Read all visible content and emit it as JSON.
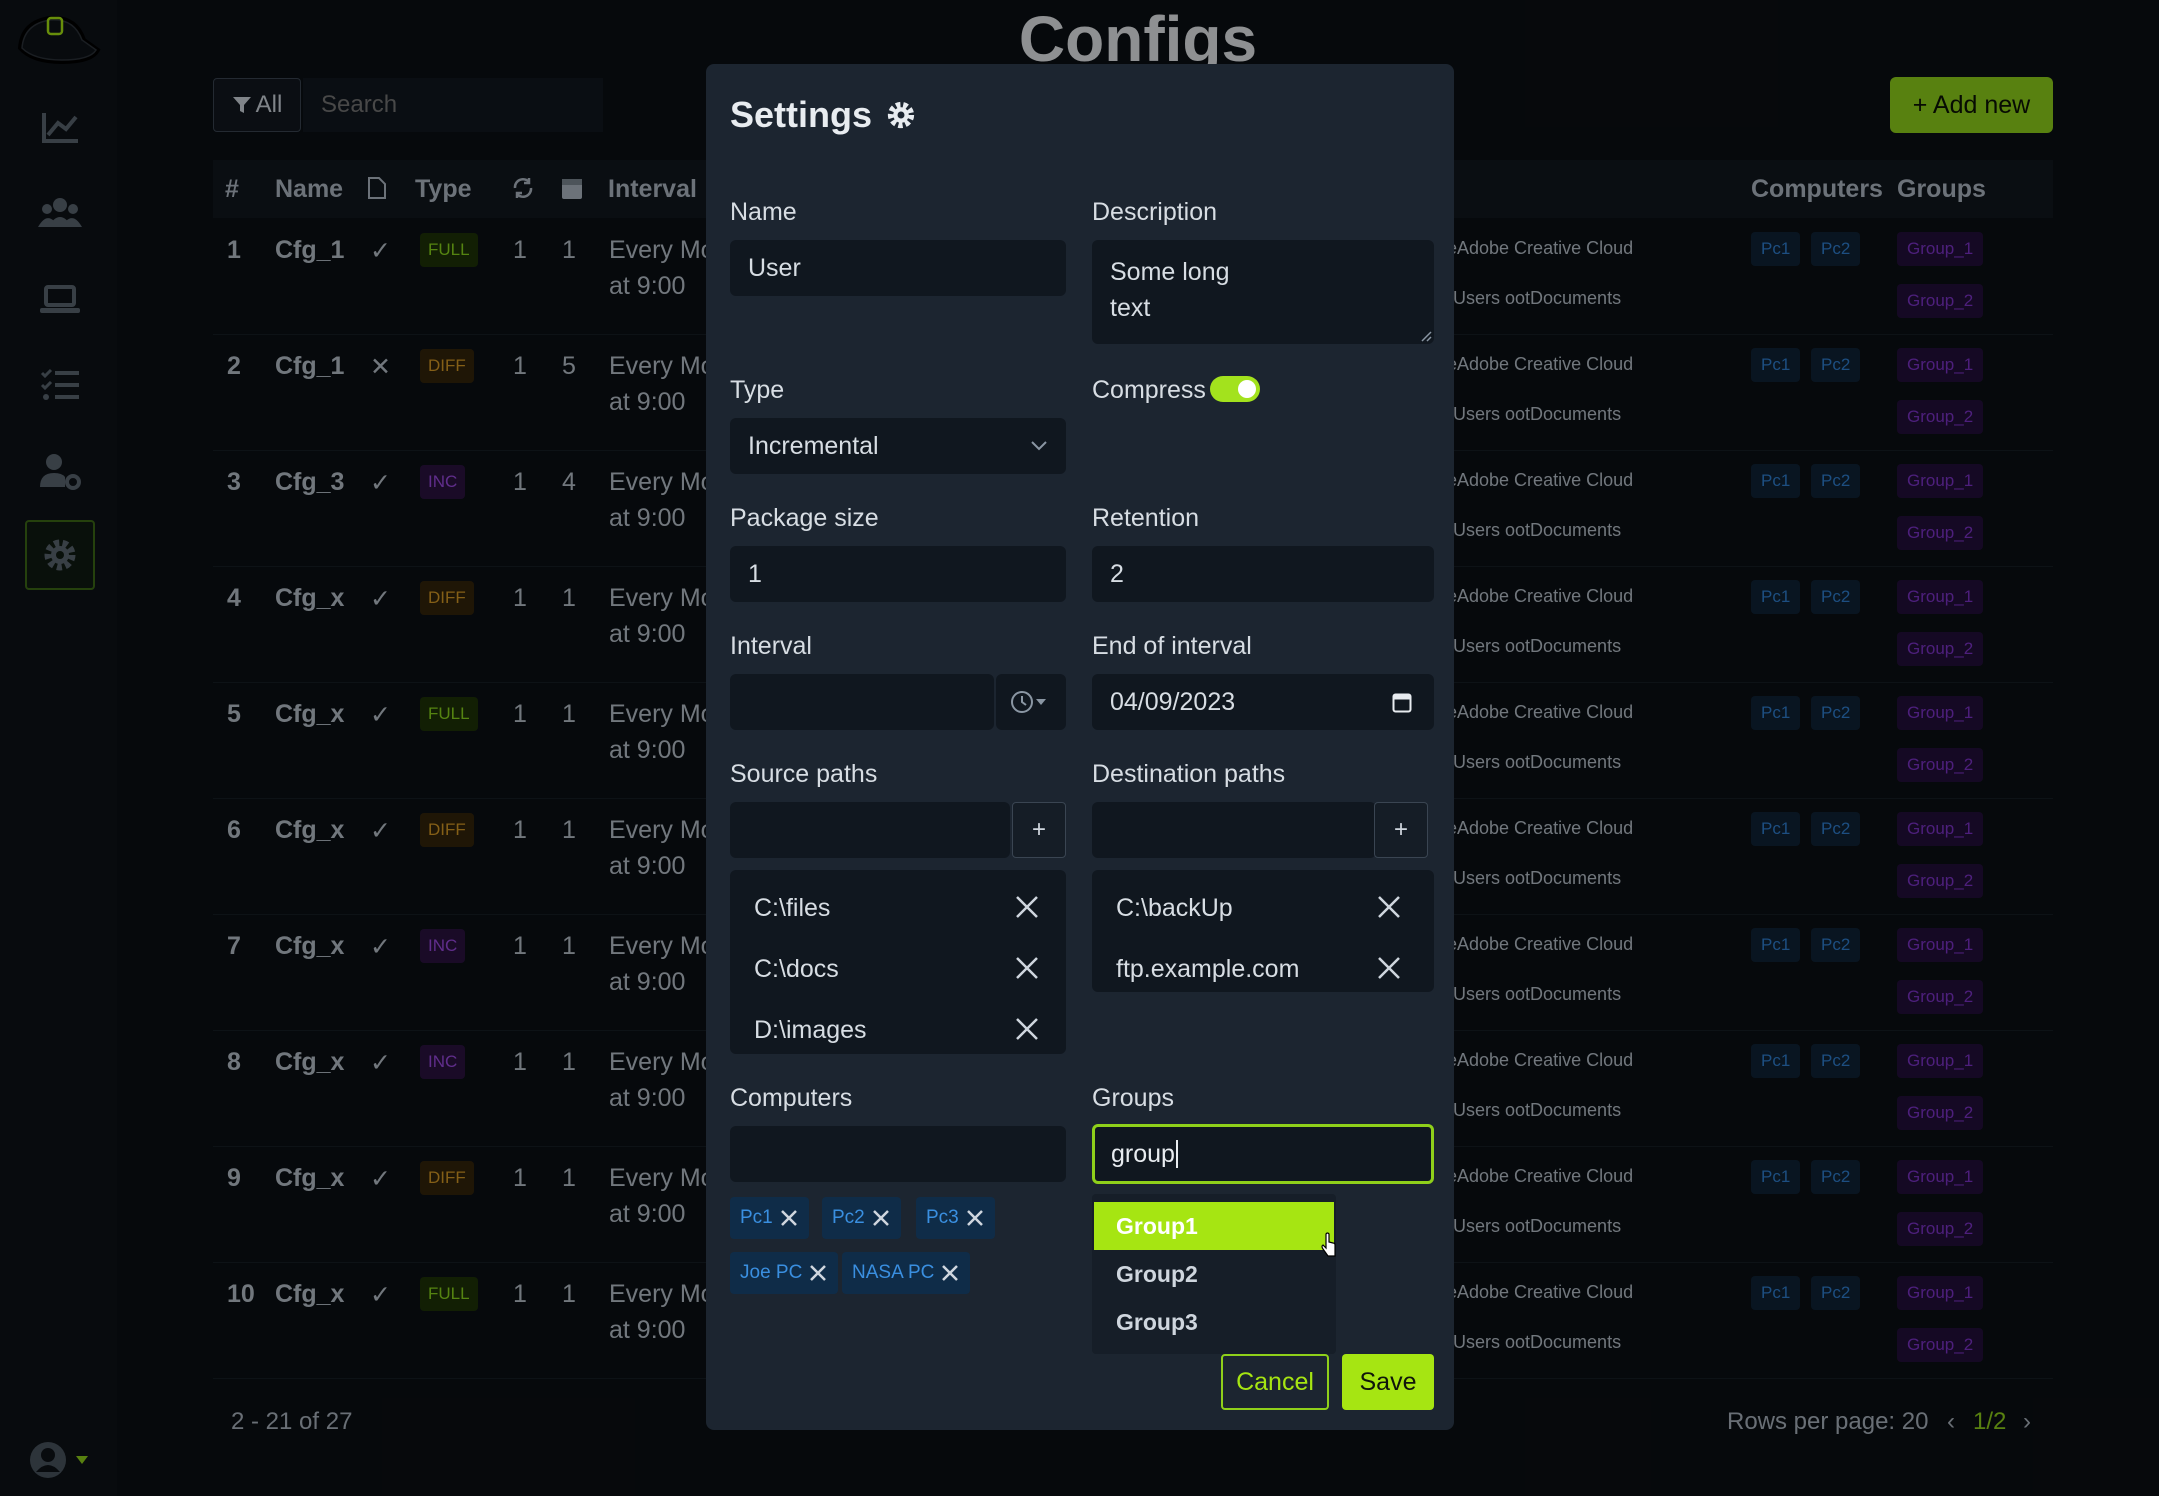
{
  "app": {
    "page_title": "Configs",
    "filter_label": "All",
    "search_placeholder": "Search",
    "add_button": "+ Add new",
    "columns": {
      "num": "#",
      "name": "Name",
      "type": "Type",
      "interval": "Interval",
      "computers": "Computers",
      "groups": "Groups"
    },
    "rows": [
      {
        "num": "1",
        "name": "Cfg_1",
        "check": "✓",
        "type": "FULL",
        "c1": "1",
        "c2": "1",
        "interval1": "Every Mo",
        "interval2": "at 9:00",
        "source": "eAdobe Creative Cloud",
        "dest": "Users ootDocuments",
        "pc1": "Pc1",
        "pc2": "Pc2",
        "g1": "Group_1",
        "g2": "Group_2"
      },
      {
        "num": "2",
        "name": "Cfg_1",
        "check": "✕",
        "type": "DIFF",
        "c1": "1",
        "c2": "5",
        "interval1": "Every Mo",
        "interval2": "at 9:00",
        "source": "eAdobe Creative Cloud",
        "dest": "Users ootDocuments",
        "pc1": "Pc1",
        "pc2": "Pc2",
        "g1": "Group_1",
        "g2": "Group_2"
      },
      {
        "num": "3",
        "name": "Cfg_3",
        "check": "✓",
        "type": "INC",
        "c1": "1",
        "c2": "4",
        "interval1": "Every Mo",
        "interval2": "at 9:00",
        "source": "eAdobe Creative Cloud",
        "dest": "Users ootDocuments",
        "pc1": "Pc1",
        "pc2": "Pc2",
        "g1": "Group_1",
        "g2": "Group_2"
      },
      {
        "num": "4",
        "name": "Cfg_x",
        "check": "✓",
        "type": "DIFF",
        "c1": "1",
        "c2": "1",
        "interval1": "Every Mo",
        "interval2": "at 9:00",
        "source": "eAdobe Creative Cloud",
        "dest": "Users ootDocuments",
        "pc1": "Pc1",
        "pc2": "Pc2",
        "g1": "Group_1",
        "g2": "Group_2"
      },
      {
        "num": "5",
        "name": "Cfg_x",
        "check": "✓",
        "type": "FULL",
        "c1": "1",
        "c2": "1",
        "interval1": "Every Mo",
        "interval2": "at 9:00",
        "source": "eAdobe Creative Cloud",
        "dest": "Users ootDocuments",
        "pc1": "Pc1",
        "pc2": "Pc2",
        "g1": "Group_1",
        "g2": "Group_2"
      },
      {
        "num": "6",
        "name": "Cfg_x",
        "check": "✓",
        "type": "DIFF",
        "c1": "1",
        "c2": "1",
        "interval1": "Every Mo",
        "interval2": "at 9:00",
        "source": "eAdobe Creative Cloud",
        "dest": "Users ootDocuments",
        "pc1": "Pc1",
        "pc2": "Pc2",
        "g1": "Group_1",
        "g2": "Group_2"
      },
      {
        "num": "7",
        "name": "Cfg_x",
        "check": "✓",
        "type": "INC",
        "c1": "1",
        "c2": "1",
        "interval1": "Every Mo",
        "interval2": "at 9:00",
        "source": "eAdobe Creative Cloud",
        "dest": "Users ootDocuments",
        "pc1": "Pc1",
        "pc2": "Pc2",
        "g1": "Group_1",
        "g2": "Group_2"
      },
      {
        "num": "8",
        "name": "Cfg_x",
        "check": "✓",
        "type": "INC",
        "c1": "1",
        "c2": "1",
        "interval1": "Every Mo",
        "interval2": "at 9:00",
        "source": "eAdobe Creative Cloud",
        "dest": "Users ootDocuments",
        "pc1": "Pc1",
        "pc2": "Pc2",
        "g1": "Group_1",
        "g2": "Group_2"
      },
      {
        "num": "9",
        "name": "Cfg_x",
        "check": "✓",
        "type": "DIFF",
        "c1": "1",
        "c2": "1",
        "interval1": "Every Mo",
        "interval2": "at 9:00",
        "source": "eAdobe Creative Cloud",
        "dest": "Users ootDocuments",
        "pc1": "Pc1",
        "pc2": "Pc2",
        "g1": "Group_1",
        "g2": "Group_2"
      },
      {
        "num": "10",
        "name": "Cfg_x",
        "check": "✓",
        "type": "FULL",
        "c1": "1",
        "c2": "1",
        "interval1": "Every Mo",
        "interval2": "at 9:00",
        "source": "eAdobe Creative Cloud",
        "dest": "Users ootDocuments",
        "pc1": "Pc1",
        "pc2": "Pc2",
        "g1": "Group_1",
        "g2": "Group_2"
      }
    ],
    "pager_range": "2 - 21 of 27",
    "rows_per_page": "Rows per page: 20",
    "page": "1/2",
    "nav_icons": [
      "chart-icon",
      "users-icon",
      "laptop-icon",
      "tasks-icon",
      "user-settings-icon",
      "gear-icon"
    ]
  },
  "modal": {
    "title": "Settings",
    "name_label": "Name",
    "name_value": "User",
    "description_label": "Description",
    "description_line1": "Some long",
    "description_line2": "text",
    "type_label": "Type",
    "type_value": "Incremental",
    "compress_label": "Compress",
    "compress_on": true,
    "package_label": "Package size",
    "package_value": "1",
    "retention_label": "Retention",
    "retention_value": "2",
    "interval_label": "Interval",
    "interval_value": "",
    "end_label": "End of interval",
    "end_value": "04/09/2023",
    "source_label": "Source paths",
    "sources": [
      "C:\\files",
      "C:\\docs",
      "D:\\images"
    ],
    "dest_label": "Destination paths",
    "destinations": [
      "C:\\backUp",
      "ftp.example.com"
    ],
    "plus": "+",
    "computers_label": "Computers",
    "computers": [
      "Pc1",
      "Pc2",
      "Pc3",
      "Joe PC",
      "NASA PC"
    ],
    "groups_label": "Groups",
    "groups_query": "group",
    "group_options": [
      "Group1",
      "Group2",
      "Group3"
    ],
    "cancel": "Cancel",
    "save": "Save"
  },
  "colors": {
    "accent": "#a6e512",
    "background": "#0b0f14",
    "modal": "#1c2530"
  }
}
